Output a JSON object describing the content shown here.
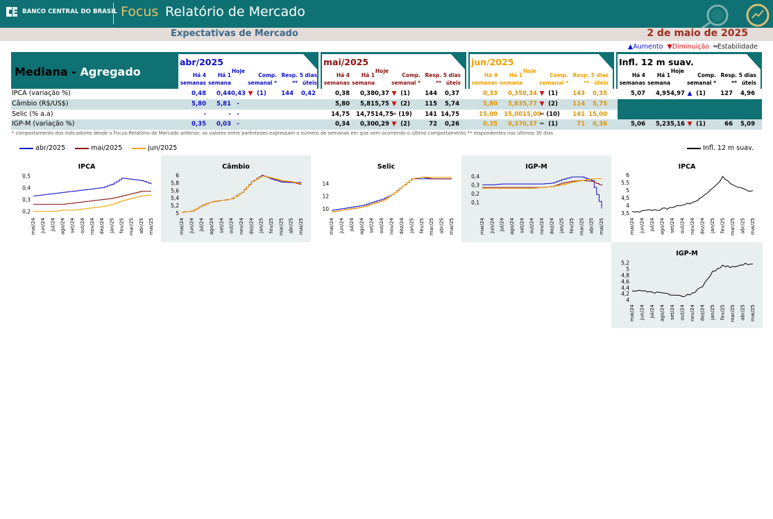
{
  "header": {
    "bank_name": "BANCO CENTRAL DO BRASIL",
    "focus": "Focus",
    "report": "Relatório de Mercado",
    "subtitle": "Expectativas de Mercado",
    "date": "2 de maio de 2025"
  },
  "legend_top": {
    "up": "▲Aumento",
    "down": "▼Diminuição",
    "eq": "═Estabilidade"
  },
  "table": {
    "label_main": "Mediana - ",
    "label_agg": "Agregado",
    "columns": [
      "Há 4 semanas",
      "Há 1 semana",
      "Hoje",
      "Comp. semanal *",
      "Resp. **",
      "5 dias úteis"
    ],
    "col_lines": [
      [
        "Há 4",
        "semanas"
      ],
      [
        "Há 1",
        "semana"
      ],
      [
        "",
        "Hoje"
      ],
      [
        "Comp.",
        "semanal *"
      ],
      [
        "Resp.",
        "**"
      ],
      [
        "5 dias",
        "úteis"
      ]
    ],
    "rows": [
      "IPCA (variação %)",
      "Câmbio (R$/US$)",
      "Selic (% a.a)",
      "IGP-M (variação %)"
    ],
    "blocks": [
      {
        "title": "abr/2025",
        "color": "#1010c8",
        "data": [
          [
            "0,48",
            "0,44",
            "0,43",
            "▼",
            "(1)",
            "144",
            "0,42"
          ],
          [
            "5,80",
            "5,81",
            "-",
            "",
            "",
            "",
            ""
          ],
          [
            "-",
            "-",
            "-",
            "",
            "",
            "",
            ""
          ],
          [
            "0,35",
            "0,03",
            "-",
            "",
            "",
            "",
            ""
          ]
        ]
      },
      {
        "title": "mai/2025",
        "color": "#8b1010",
        "data": [
          [
            "0,38",
            "0,38",
            "0,37",
            "▼",
            "(1)",
            "144",
            "0,37"
          ],
          [
            "5,80",
            "5,81",
            "5,75",
            "▼",
            "(2)",
            "115",
            "5,74"
          ],
          [
            "14,75",
            "14,75",
            "14,75",
            "═",
            "(19)",
            "141",
            "14,75"
          ],
          [
            "0,34",
            "0,30",
            "0,29",
            "▼",
            "(2)",
            "72",
            "0,26"
          ]
        ]
      },
      {
        "title": "jun/2025",
        "color": "#f0a000",
        "data": [
          [
            "0,33",
            "0,35",
            "0,34",
            "▼",
            "(1)",
            "143",
            "0,35"
          ],
          [
            "5,80",
            "5,83",
            "5,77",
            "▼",
            "(2)",
            "114",
            "5,75"
          ],
          [
            "15,00",
            "15,00",
            "15,00",
            "═",
            "(10)",
            "141",
            "15,00"
          ],
          [
            "0,35",
            "0,37",
            "0,37",
            "═",
            "(1)",
            "71",
            "0,36"
          ]
        ]
      },
      {
        "title": "Infl. 12 m suav.",
        "color": "#000000",
        "data": [
          [
            "5,07",
            "4,95",
            "4,97",
            "▲",
            "(1)",
            "127",
            "4,96"
          ],
          [
            "",
            "",
            "",
            "",
            "",
            "",
            ""
          ],
          [
            "",
            "",
            "",
            "",
            "",
            "",
            ""
          ],
          [
            "5,06",
            "5,23",
            "5,16",
            "▼",
            "(1)",
            "66",
            "5,09"
          ]
        ]
      }
    ],
    "footnote": "* comportamento dos indicadores desde o Focus-Relatório de Mercado anterior; os valores entre parênteses expressam o número de semanas em que vem ocorrendo o último comportamento ** respondentes nos últimos 30 dias"
  },
  "chart_legend": {
    "series": [
      {
        "name": "abr/2025",
        "color": "#1010c8"
      },
      {
        "name": "mai/2025",
        "color": "#8b1010"
      },
      {
        "name": "jun/2025",
        "color": "#f0a000"
      }
    ],
    "infl": {
      "name": "Infl. 12 m suav.",
      "color": "#000000"
    }
  },
  "chart_data": [
    {
      "type": "line",
      "title": "IPCA",
      "x": [
        "mai/24",
        "jun/24",
        "jul/24",
        "ago/24",
        "set/24",
        "out/24",
        "nov/24",
        "dez/24",
        "jan/25",
        "fev/25",
        "mar/25",
        "abr/25",
        "mai/25"
      ],
      "yticks": [
        "0,5",
        "0,4",
        "0,3",
        "0,2"
      ],
      "ylim": [
        0.18,
        0.52
      ],
      "series": [
        {
          "name": "abr/2025",
          "color": "#1010c8",
          "values": [
            0.33,
            0.34,
            0.35,
            0.36,
            0.37,
            0.38,
            0.39,
            0.4,
            0.43,
            0.48,
            0.47,
            0.46,
            0.43
          ]
        },
        {
          "name": "mai/2025",
          "color": "#8b1010",
          "values": [
            0.26,
            0.26,
            0.26,
            0.26,
            0.27,
            0.28,
            0.29,
            0.3,
            0.31,
            0.33,
            0.35,
            0.37,
            0.37
          ]
        },
        {
          "name": "jun/2025",
          "color": "#f0a000",
          "values": [
            0.2,
            0.2,
            0.2,
            0.21,
            0.21,
            0.22,
            0.23,
            0.24,
            0.26,
            0.29,
            0.31,
            0.33,
            0.34
          ]
        }
      ]
    },
    {
      "type": "line",
      "title": "Câmbio",
      "x": [
        "mai/24",
        "jun/24",
        "jul/24",
        "ago/24",
        "set/24",
        "out/24",
        "nov/24",
        "dez/24",
        "jan/25",
        "fev/25",
        "mar/25",
        "abr/25",
        "mai/25"
      ],
      "yticks": [
        "6",
        "5,8",
        "5,6",
        "5,4",
        "5,2",
        "5"
      ],
      "ylim": [
        4.98,
        6.05
      ],
      "series": [
        {
          "name": "abr/2025",
          "color": "#1010c8",
          "values": [
            5.02,
            5.05,
            5.2,
            5.3,
            5.33,
            5.38,
            5.55,
            5.83,
            6.0,
            5.9,
            5.82,
            5.81,
            5.81
          ]
        },
        {
          "name": "mai/2025",
          "color": "#8b1010",
          "values": [
            5.02,
            5.05,
            5.2,
            5.3,
            5.33,
            5.38,
            5.55,
            5.83,
            5.99,
            5.92,
            5.85,
            5.82,
            5.75
          ]
        },
        {
          "name": "jun/2025",
          "color": "#f0a000",
          "values": [
            5.02,
            5.05,
            5.2,
            5.3,
            5.33,
            5.38,
            5.55,
            5.83,
            5.98,
            5.93,
            5.86,
            5.83,
            5.77
          ]
        }
      ]
    },
    {
      "type": "line",
      "title": "Selic",
      "x": [
        "mai/24",
        "jun/24",
        "jul/24",
        "ago/24",
        "set/24",
        "out/24",
        "nov/24",
        "dez/24",
        "jan/25",
        "fev/25",
        "mar/25",
        "abr/25",
        "mai/25"
      ],
      "yticks": [
        "14",
        "12",
        "10"
      ],
      "ylim": [
        9.2,
        15.6
      ],
      "series": [
        {
          "name": "abr/2025",
          "color": "#1010c8",
          "values": [
            9.75,
            10.0,
            10.25,
            10.5,
            11.0,
            11.5,
            12.25,
            13.5,
            14.75,
            14.75,
            14.75,
            14.75,
            14.75
          ]
        },
        {
          "name": "mai/2025",
          "color": "#8b1010",
          "values": [
            9.5,
            9.75,
            10.0,
            10.25,
            10.75,
            11.25,
            12.25,
            13.5,
            14.75,
            15.0,
            14.75,
            14.75,
            14.75
          ]
        },
        {
          "name": "jun/2025",
          "color": "#f0a000",
          "values": [
            9.5,
            9.75,
            10.0,
            10.25,
            10.75,
            11.25,
            12.25,
            13.5,
            14.75,
            15.0,
            15.0,
            15.0,
            15.0
          ]
        }
      ]
    },
    {
      "type": "line",
      "title": "IGP-M",
      "x": [
        "mai/24",
        "jun/24",
        "jul/24",
        "ago/24",
        "set/24",
        "out/24",
        "nov/24",
        "dez/24",
        "jan/25",
        "fev/25",
        "mar/25",
        "abr/25",
        "mai/25"
      ],
      "yticks": [
        "0,4",
        "0,3",
        "0,2",
        "0,1"
      ],
      "ylim": [
        -0.03,
        0.43
      ],
      "series": [
        {
          "name": "abr/2025",
          "color": "#1010c8",
          "values": [
            0.3,
            0.3,
            0.31,
            0.31,
            0.31,
            0.31,
            0.31,
            0.32,
            0.36,
            0.39,
            0.39,
            0.35,
            0.03
          ]
        },
        {
          "name": "mai/2025",
          "color": "#8b1010",
          "values": [
            0.27,
            0.27,
            0.27,
            0.27,
            0.27,
            0.27,
            0.27,
            0.28,
            0.32,
            0.34,
            0.35,
            0.34,
            0.29
          ]
        },
        {
          "name": "jun/2025",
          "color": "#f0a000",
          "values": [
            0.26,
            0.26,
            0.26,
            0.26,
            0.26,
            0.26,
            0.27,
            0.28,
            0.3,
            0.33,
            0.35,
            0.37,
            0.37
          ]
        }
      ]
    },
    {
      "type": "line",
      "title": "IPCA",
      "x": [
        "mai/24",
        "jun/24",
        "jul/24",
        "ago/24",
        "set/24",
        "out/24",
        "nov/24",
        "dez/24",
        "jan/25",
        "fev/25",
        "mar/25",
        "abr/25",
        "mai/25"
      ],
      "yticks": [
        "6",
        "5,5",
        "5",
        "4,5",
        "4",
        "3,5"
      ],
      "ylim": [
        3.45,
        6.1
      ],
      "series": [
        {
          "name": "Infl. 12 m suav.",
          "color": "#000000",
          "values": [
            3.6,
            3.62,
            3.65,
            3.75,
            3.85,
            4.05,
            4.15,
            4.55,
            5.1,
            5.85,
            5.3,
            5.05,
            4.97
          ]
        }
      ]
    },
    {
      "type": "line",
      "title": "IGP-M",
      "x": [
        "mai/24",
        "jun/24",
        "jul/24",
        "ago/24",
        "set/24",
        "out/24",
        "nov/24",
        "dez/24",
        "jan/25",
        "fev/25",
        "mar/25",
        "abr/25",
        "mai/25"
      ],
      "yticks": [
        "5,2",
        "5",
        "4,8",
        "4,6",
        "4,4",
        "4,2",
        "4"
      ],
      "ylim": [
        3.98,
        5.28
      ],
      "series": [
        {
          "name": "Infl. 12 m suav.",
          "color": "#000000",
          "values": [
            4.3,
            4.28,
            4.25,
            4.22,
            4.15,
            4.12,
            4.2,
            4.45,
            4.9,
            5.1,
            5.05,
            5.15,
            5.16
          ]
        }
      ]
    }
  ]
}
